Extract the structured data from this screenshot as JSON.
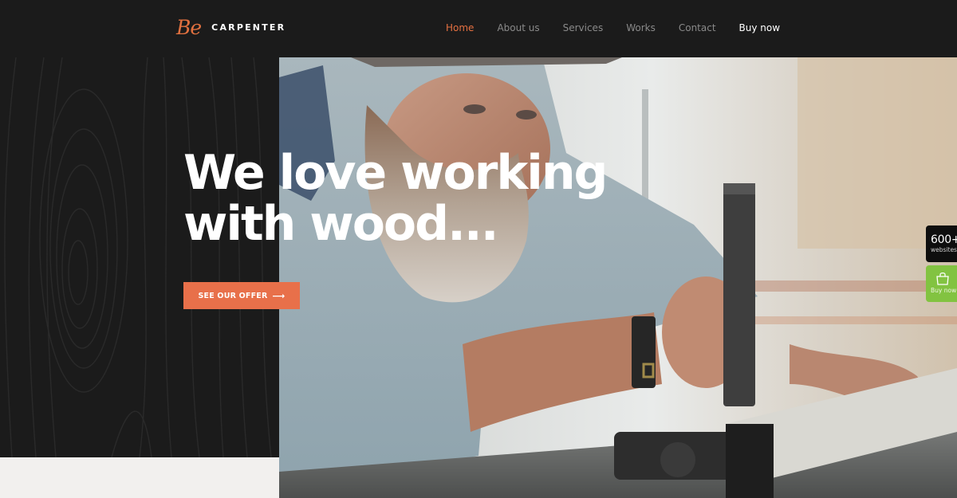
{
  "header": {
    "logo_mark": "Be",
    "logo_text": "CARPENTER",
    "nav": [
      {
        "label": "Home",
        "active": true
      },
      {
        "label": "About us",
        "active": false
      },
      {
        "label": "Services",
        "active": false
      },
      {
        "label": "Works",
        "active": false
      },
      {
        "label": "Contact",
        "active": false
      },
      {
        "label": "Buy now",
        "active": false
      }
    ]
  },
  "hero": {
    "title_line1": "We love working",
    "title_line2": "with wood...",
    "cta_label": "SEE OUR OFFER",
    "cta_icon": "arrow-right-icon",
    "image_description": "bearded carpenter in denim shirt and cap working at a table saw"
  },
  "side_widgets": {
    "websites_count": "600+",
    "websites_label": "websites",
    "buy_icon": "shopping-bag-icon",
    "buy_label": "Buy now"
  },
  "colors": {
    "accent": "#e8704a",
    "dark": "#1b1b1b",
    "buy_green": "#82c341",
    "light_panel": "#f2f0ee"
  }
}
